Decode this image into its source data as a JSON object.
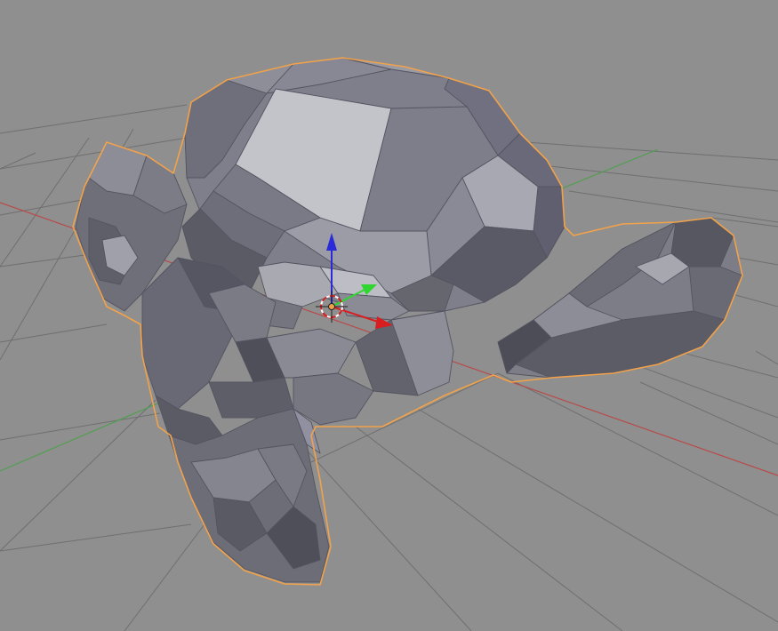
{
  "viewport": {
    "background": "#8f8f8f",
    "grid_line_color": "#6f6f6f",
    "x_axis_color": "#b84a4a",
    "y_axis_color": "#4f9f4f"
  },
  "object": {
    "selection_outline_color": "#f2a24a",
    "face_highlight_color": "#c3c3ca",
    "face_mid_color": "#9a9aa6",
    "face_shadow_color": "#5a5a66"
  },
  "gizmo": {
    "z_arrow_color": "#2a2ad8",
    "x_arrow_color": "#d81e1e",
    "y_arrow_color": "#2fd62f",
    "cursor_icon": "3d-cursor-icon"
  }
}
